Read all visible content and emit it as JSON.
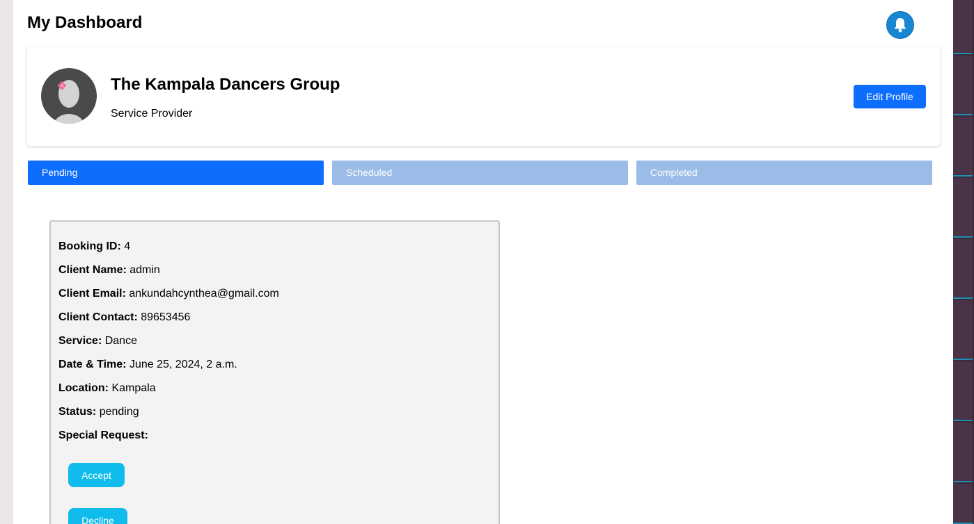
{
  "header": {
    "title": "My Dashboard",
    "notification_icon": "bell-icon"
  },
  "profile": {
    "name": "The Kampala Dancers Group",
    "role": "Service Provider",
    "edit_label": "Edit Profile",
    "avatar_icon": "avatar-icon"
  },
  "tabs": [
    {
      "label": "Pending",
      "active": true
    },
    {
      "label": "Scheduled",
      "active": false
    },
    {
      "label": "Completed",
      "active": false
    }
  ],
  "booking": {
    "fields": [
      {
        "label": "Booking ID:",
        "value": "4"
      },
      {
        "label": "Client Name:",
        "value": "admin"
      },
      {
        "label": "Client Email:",
        "value": "ankundahcynthea@gmail.com"
      },
      {
        "label": "Client Contact:",
        "value": "89653456"
      },
      {
        "label": "Service:",
        "value": "Dance"
      },
      {
        "label": "Date & Time:",
        "value": "June 25, 2024, 2 a.m."
      },
      {
        "label": "Location:",
        "value": "Kampala"
      },
      {
        "label": "Status:",
        "value": "pending"
      },
      {
        "label": "Special Request:",
        "value": ""
      }
    ],
    "accept_label": "Accept",
    "decline_label": "Decline"
  },
  "colors": {
    "primary": "#0d6efd",
    "tab_inactive": "#9bbce6",
    "action": "#0fbcec",
    "bell": "#1787d3"
  }
}
